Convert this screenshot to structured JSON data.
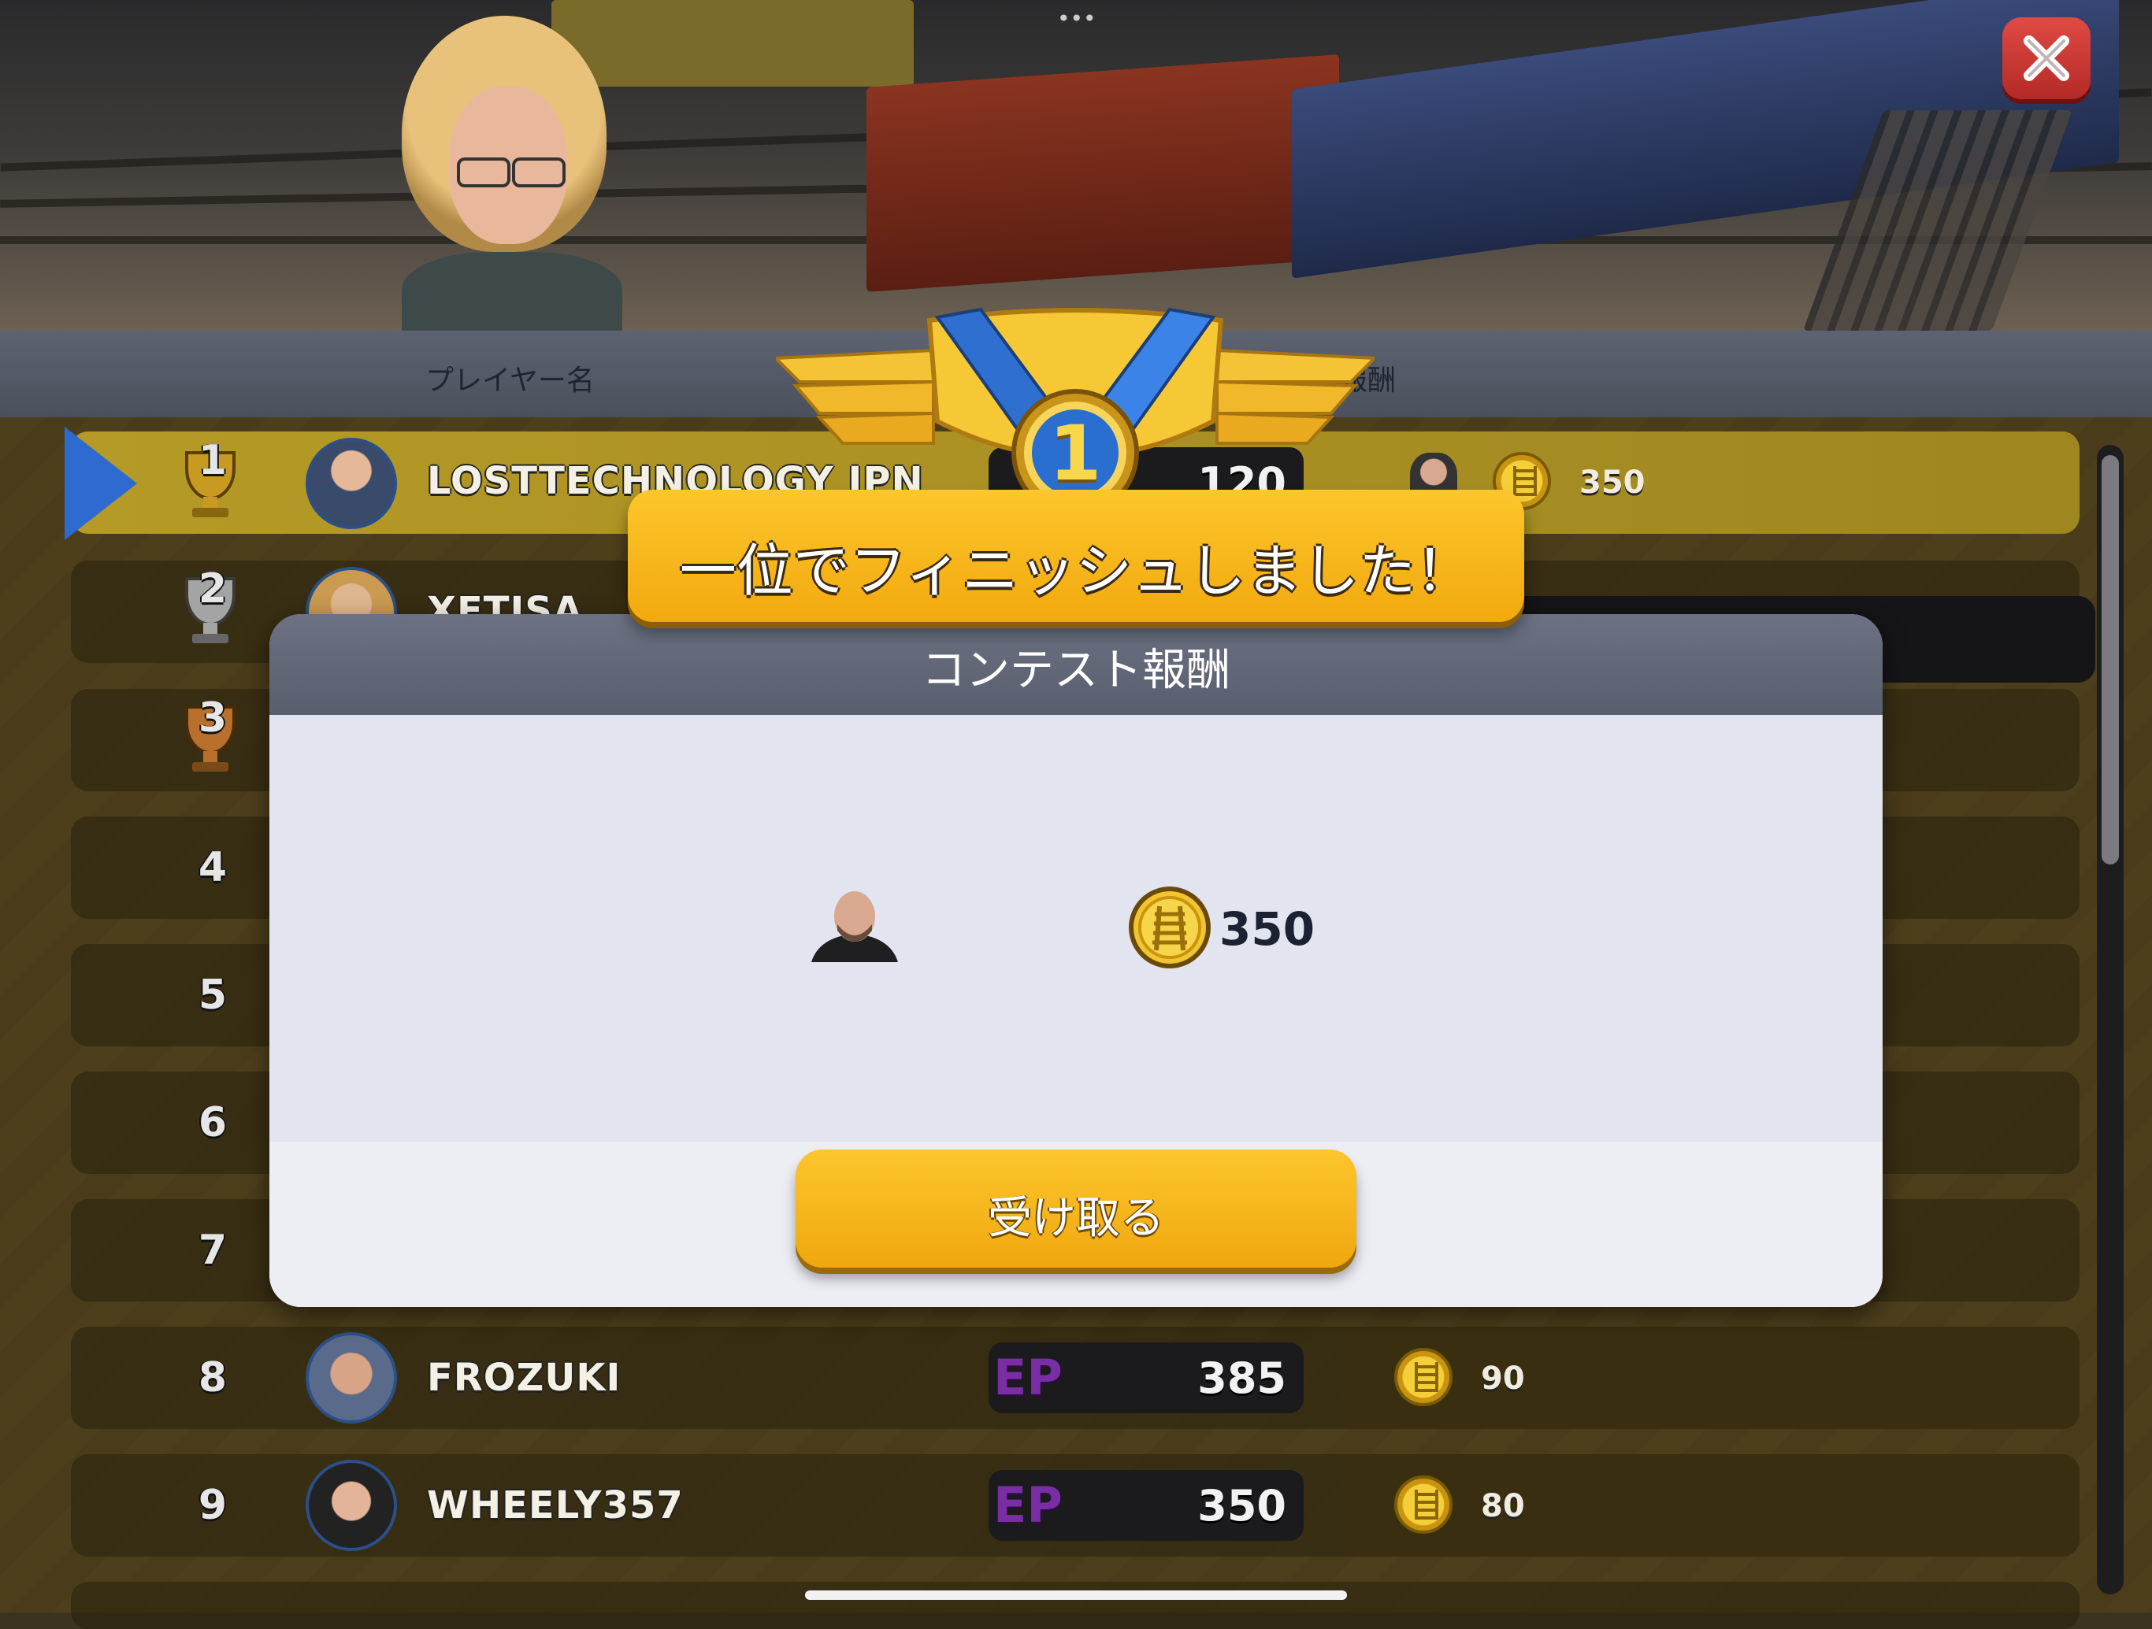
{
  "header": {
    "col_player": "プレイヤー名",
    "col_reward": "報酬"
  },
  "leaderboard": [
    {
      "rank": "1",
      "name": "LOSTTECHNOLOGY JPN",
      "ep": "120",
      "reward": "350",
      "highlight": true
    },
    {
      "rank": "2",
      "name": "XETISA"
    },
    {
      "rank": "3"
    },
    {
      "rank": "4"
    },
    {
      "rank": "5"
    },
    {
      "rank": "6"
    },
    {
      "rank": "7"
    },
    {
      "rank": "8",
      "name": "FROZUKI",
      "ep": "385",
      "reward": "90"
    },
    {
      "rank": "9",
      "name": "WHEELY357",
      "ep": "350",
      "reward": "80"
    }
  ],
  "ep_tag": "EP",
  "modal": {
    "banner": "一位でフィニッシュしました！",
    "title": "コンテスト報酬",
    "reward_amount": "350",
    "claim_label": "受け取る"
  },
  "medal": {
    "number": "1"
  },
  "icons": {
    "close": "close-icon",
    "coin": "rail-coin-icon",
    "trophy": "trophy-icon",
    "character": "character-portrait-icon"
  },
  "colors": {
    "gold": "#fcc62c",
    "modal_header": "#6c7283",
    "close_red": "#d63a36",
    "ep_purple": "#7a2ea6"
  }
}
